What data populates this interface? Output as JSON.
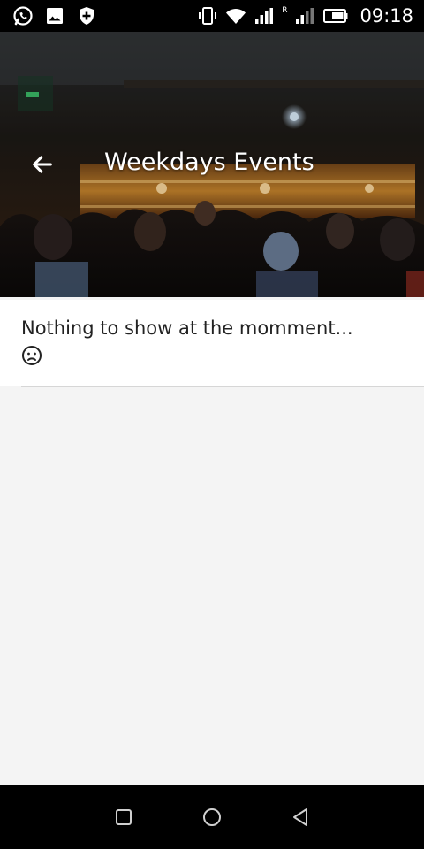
{
  "status_bar": {
    "time": "09:18",
    "roaming_indicator": "R",
    "left_icons": [
      "whatsapp-icon",
      "gallery-icon",
      "shield-plus-icon"
    ],
    "right_icons": [
      "vibrate-icon",
      "wifi-icon",
      "signal-icon",
      "signal-roaming-icon",
      "battery-icon"
    ]
  },
  "header": {
    "title": "Weekdays Events",
    "back_icon": "arrow-back-icon",
    "background": "bar-crowd-photo"
  },
  "content": {
    "empty_message": "Nothing to show at the momment...",
    "empty_icon": "sad-face-icon"
  },
  "nav_bar": {
    "buttons": [
      "recents-icon",
      "home-icon",
      "back-icon"
    ]
  },
  "colors": {
    "status_bar_bg": "#000000",
    "page_bg": "#f4f4f4",
    "card_bg": "#ffffff",
    "divider": "#d6d6d6",
    "text": "#222222"
  }
}
